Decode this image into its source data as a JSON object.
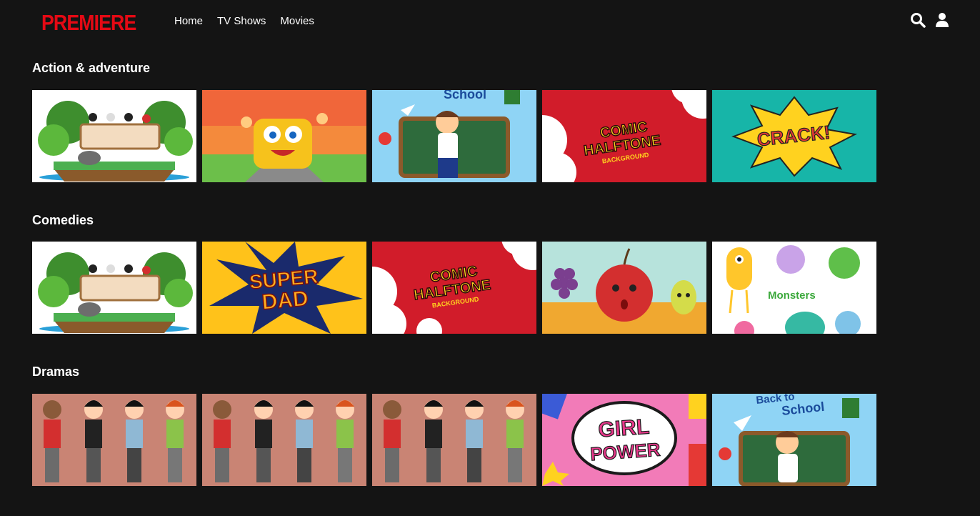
{
  "brand": {
    "logo": "PREMIERE",
    "color": "#e50914"
  },
  "nav": [
    {
      "label": "Home"
    },
    {
      "label": "TV Shows"
    },
    {
      "label": "Movies"
    }
  ],
  "header_icons": [
    "search-icon",
    "user-icon"
  ],
  "rows": [
    {
      "title": "Action & adventure",
      "tiles": [
        "island-tree-birds",
        "school-bus",
        "back-to-school",
        "comic-halftone",
        "crack"
      ]
    },
    {
      "title": "Comedies",
      "tiles": [
        "island-tree-birds",
        "super-dad",
        "comic-halftone",
        "fruits",
        "monsters"
      ]
    },
    {
      "title": "Dramas",
      "tiles": [
        "boys-phones",
        "boys-phones",
        "boys-phones",
        "girl-power",
        "back-to-school"
      ]
    }
  ],
  "artwork_text": {
    "comic1": "COMIC",
    "comic2": "HALFTONE",
    "comic3": "BACKGROUND",
    "crack": "CRACK!",
    "super": "SUPER",
    "dad": "DAD",
    "monsters": "Monsters",
    "girl": "GIRL",
    "power": "POWER",
    "back": "Back to",
    "school": "School"
  }
}
